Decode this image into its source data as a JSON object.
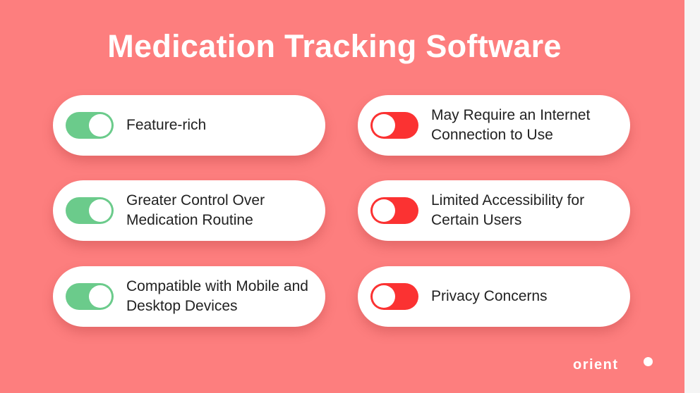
{
  "title": "Medication Tracking Software",
  "pros": [
    {
      "label": "Feature-rich",
      "state": "on"
    },
    {
      "label": "Greater Control Over Medication Routine",
      "state": "on"
    },
    {
      "label": "Compatible with Mobile and Desktop Devices",
      "state": "on"
    }
  ],
  "cons": [
    {
      "label": "May Require an Internet Connection to Use",
      "state": "off"
    },
    {
      "label": "Limited Accessibility for Certain Users",
      "state": "off"
    },
    {
      "label": "Privacy Concerns",
      "state": "off"
    }
  ],
  "logo": "orient",
  "colors": {
    "background": "#fd7e7e",
    "toggle_on": "#6bcb8b",
    "toggle_off": "#fb3232",
    "card": "#ffffff"
  }
}
